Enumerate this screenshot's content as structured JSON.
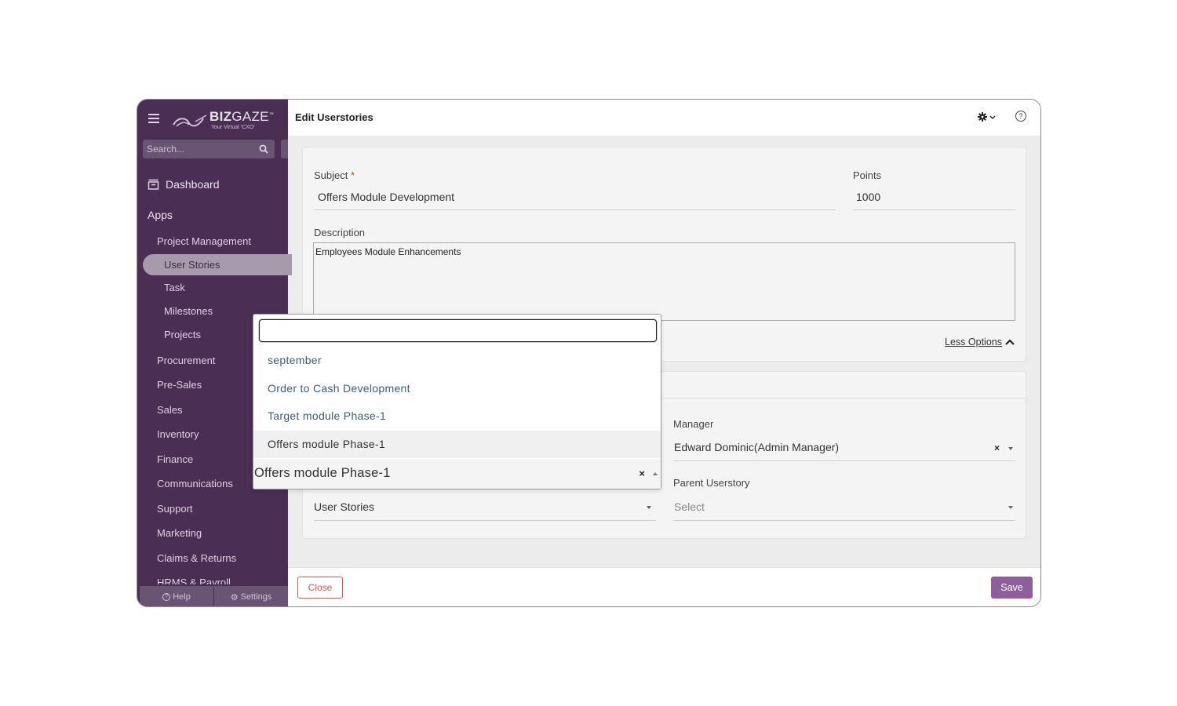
{
  "sidebar": {
    "brand": "BIZGAZE",
    "brand_bold": "BIZ",
    "brand_light": "GAZE",
    "tagline": "Your Virtual 'CXO'",
    "search_placeholder": "Search...",
    "dashboard": "Dashboard",
    "apps": "Apps",
    "items": [
      {
        "label": "Project Management",
        "level": 1
      },
      {
        "label": "User Stories",
        "level": 2,
        "active": true
      },
      {
        "label": "Task",
        "level": 2
      },
      {
        "label": "Milestones",
        "level": 2
      },
      {
        "label": "Projects",
        "level": 2
      },
      {
        "label": "Procurement",
        "level": 1
      },
      {
        "label": "Pre-Sales",
        "level": 1
      },
      {
        "label": "Sales",
        "level": 1
      },
      {
        "label": "Inventory",
        "level": 1
      },
      {
        "label": "Finance",
        "level": 1
      },
      {
        "label": "Communications",
        "level": 1
      },
      {
        "label": "Support",
        "level": 1
      },
      {
        "label": "Marketing",
        "level": 1
      },
      {
        "label": "Claims & Returns",
        "level": 1
      },
      {
        "label": "HRMS & Payroll",
        "level": 1
      }
    ],
    "footer": {
      "help": "Help",
      "settings": "Settings"
    }
  },
  "header": {
    "title": "Edit Userstories"
  },
  "form": {
    "subject_label": "Subject",
    "required_mark": "*",
    "subject_value": "Offers Module Development",
    "points_label": "Points",
    "points_value": "1000",
    "description_label": "Description",
    "description_value": "Employees Module Enhancements",
    "less_options": "Less Options",
    "manager_label": "Manager",
    "manager_value": "Edward Dominic(Admin Manager)",
    "parent_label": "Parent Userstory",
    "parent_placeholder": "Select",
    "type_value": "User Stories"
  },
  "dropdown": {
    "search_value": "",
    "options": [
      "september",
      "Order to Cash Development",
      "Target module Phase-1",
      "Offers module Phase-1"
    ],
    "highlighted_index": 3,
    "selected_value": "Offers module Phase-1",
    "clear_glyph": "×"
  },
  "footer": {
    "close_label": "Close",
    "save_label": "Save"
  },
  "colors": {
    "sidebar": "#4a2e54",
    "accent": "#8e5f9c",
    "danger": "#d9534f",
    "option_text": "#3b6172"
  }
}
